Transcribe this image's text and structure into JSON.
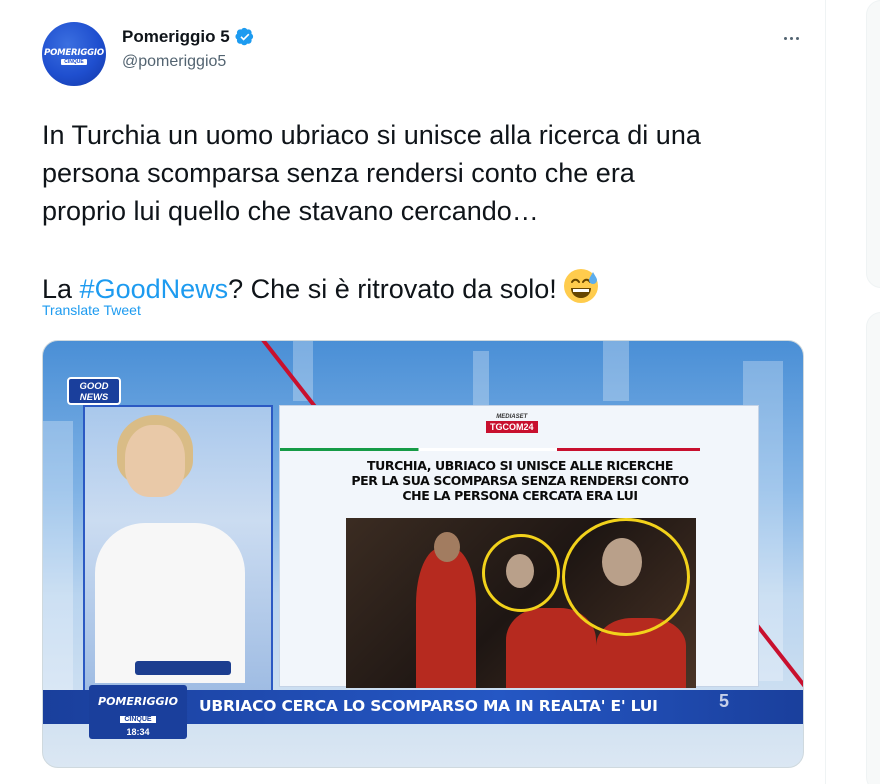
{
  "tweet": {
    "display_name": "Pomeriggio 5",
    "handle": "@pomeriggio5",
    "avatar": {
      "word": "POMERIGGIO",
      "sub": "CINQUE"
    },
    "verified_icon": "verified-badge-icon",
    "more_icon": "more-options-icon",
    "text_lines": [
      "In Turchia un uomo ubriaco si unisce alla ricerca di una",
      "persona scomparsa senza rendersi conto che era",
      "proprio lui quello che stavano cercando…"
    ],
    "last_line": {
      "prefix": "La ",
      "hashtag": "#GoodNews",
      "suffix": "? Che si è ritrovato da solo!",
      "emoji": "grinning-face-with-sweat-emoji"
    },
    "translate_label": "Translate Tweet"
  },
  "media": {
    "badge": "GOOD NEWS",
    "tg_top": "MEDIASET",
    "tg_logo": "TGCOM24",
    "headline_lines": [
      "TURCHIA, UBRIACO SI UNISCE ALLE RICERCHE",
      "PER LA SUA SCOMPARSA SENZA RENDERSI CONTO",
      "CHE LA PERSONA CERCATA ERA LUI"
    ],
    "ticker": "UBRIACO CERCA LO SCOMPARSO MA IN REALTA' E' LUI",
    "show_logo": {
      "word": "POMERIGGIO",
      "sub": "CINQUE",
      "time": "18:34"
    },
    "channel_mark": "5"
  },
  "colors": {
    "link": "#1d9bf0",
    "text": "#0f1419",
    "secondary": "#536471",
    "ticker": "#1a3f9c"
  }
}
